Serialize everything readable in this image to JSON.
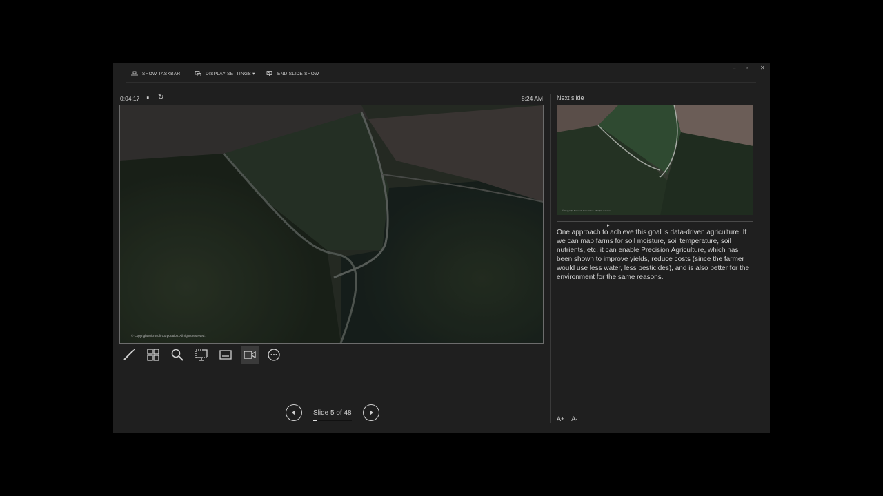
{
  "toolbar": {
    "show_taskbar": "SHOW TASKBAR",
    "display_settings": "DISPLAY SETTINGS ▾",
    "end_slide_show": "END SLIDE SHOW"
  },
  "window_controls": {
    "minimize": "–",
    "restore": "▫",
    "close": "✕"
  },
  "timer": {
    "elapsed": "0:04:17",
    "pause_glyph": "⏸",
    "reset_glyph": "↻"
  },
  "clock": "8:24 AM",
  "current_slide": {
    "copyright": "© Copyright Microsoft Corporation. All rights reserved."
  },
  "tools": [
    {
      "name": "pen-tool-icon"
    },
    {
      "name": "see-all-slides-icon"
    },
    {
      "name": "zoom-icon"
    },
    {
      "name": "black-screen-icon"
    },
    {
      "name": "subtitles-icon"
    },
    {
      "name": "camera-icon"
    },
    {
      "name": "more-options-icon"
    }
  ],
  "navigation": {
    "slide_label": "Slide 5 of 48",
    "current": 5,
    "total": 48,
    "progress_fraction": 0.104
  },
  "next_slide": {
    "label": "Next slide",
    "copyright": "© Copyright Microsoft Corporation. All rights reserved."
  },
  "notes": "One approach to achieve this goal is data-driven agriculture. If we can map farms for soil moisture, soil temperature, soil nutrients, etc. it can enable Precision Agriculture, which has been shown to improve yields, reduce costs (since the farmer would use less water, less pesticides), and is also better for the environment for the same reasons.",
  "font_controls": {
    "increase": "A+",
    "decrease": "A-"
  },
  "colors": {
    "background": "#1f1f1f",
    "outer": "#000000",
    "text": "#cfcfcf"
  }
}
